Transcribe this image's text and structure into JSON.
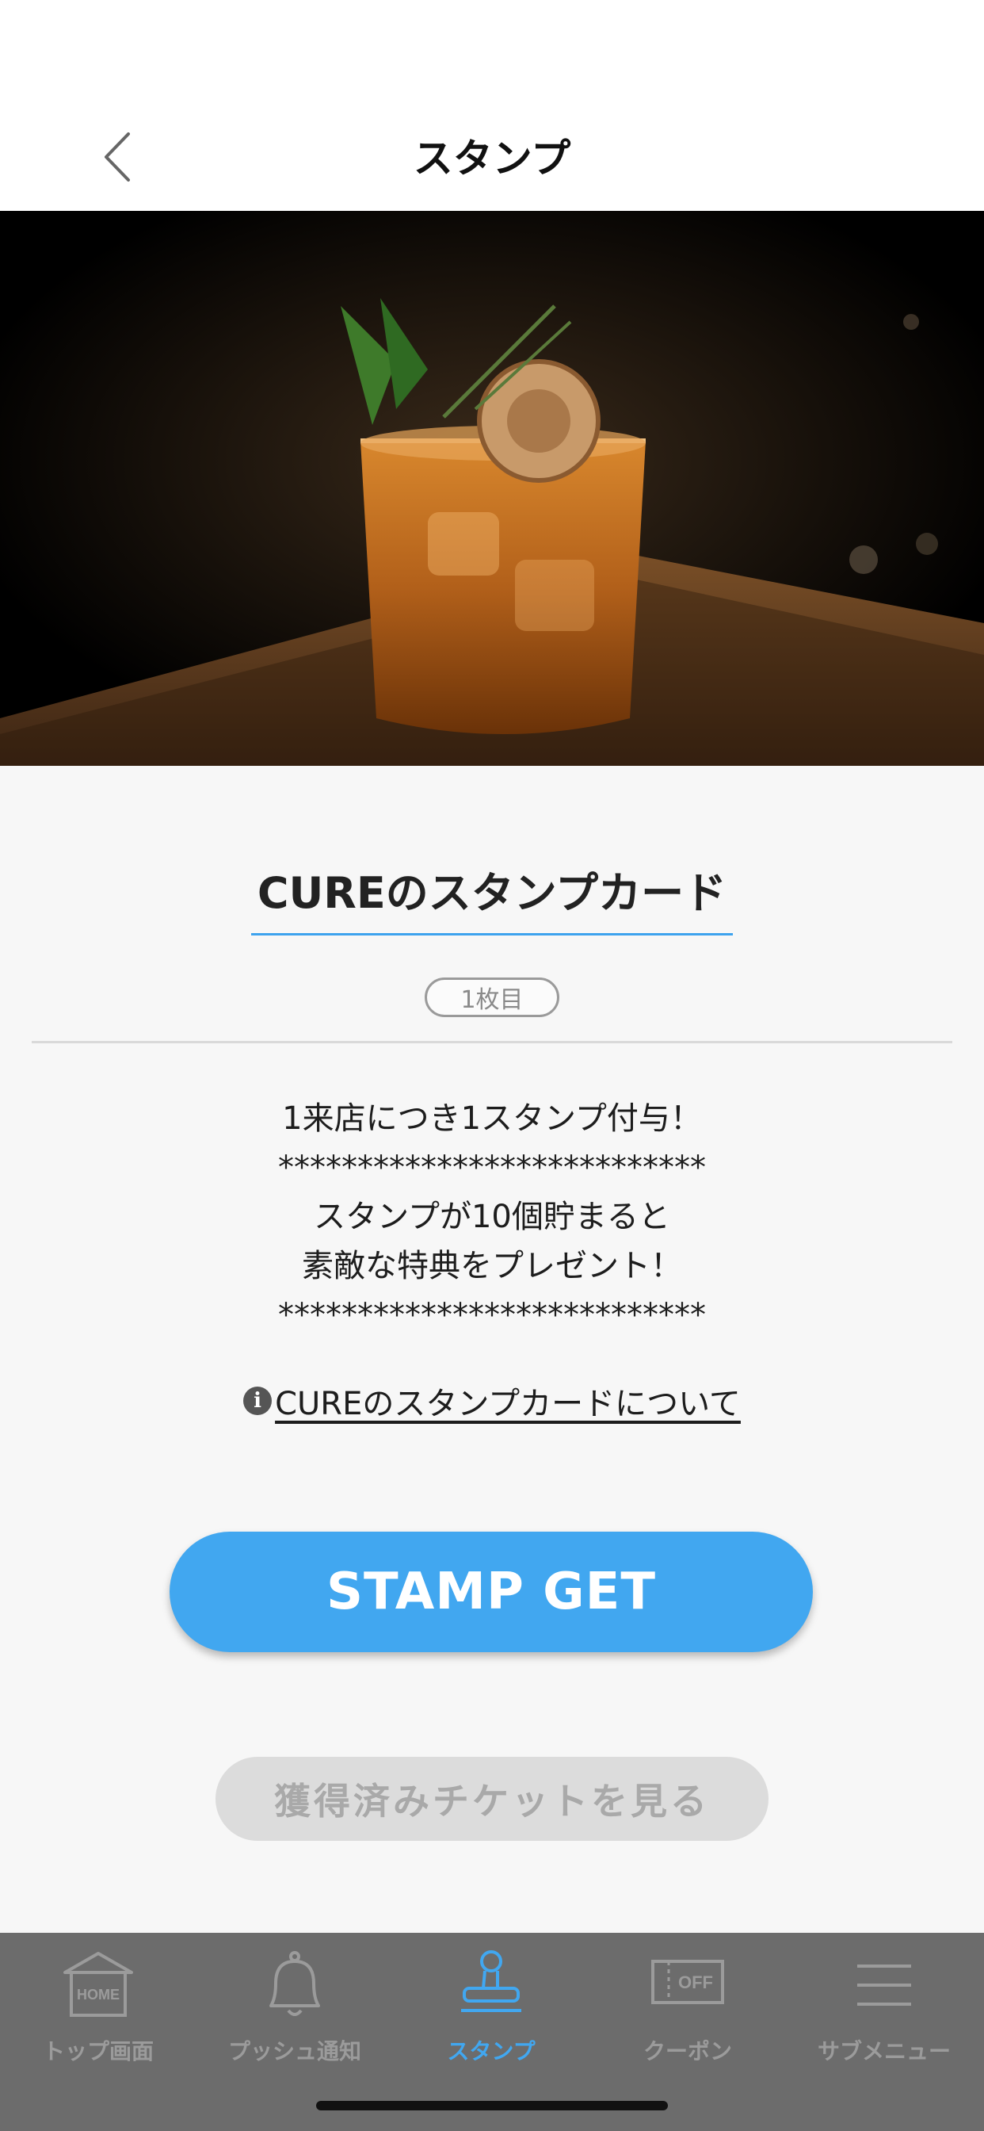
{
  "header": {
    "title": "スタンプ"
  },
  "card": {
    "title": "CUREのスタンプカード",
    "sheet": "1枚目",
    "description": [
      "1来店につき1スタンプ付与！",
      "***************************",
      "スタンプが10個貯まると",
      "素敵な特典をプレゼント！",
      "***************************"
    ],
    "about_link": "CUREのスタンプカードについて"
  },
  "buttons": {
    "stamp_get": "STAMP GET",
    "tickets": "獲得済みチケットを見る"
  },
  "tabbar": {
    "active": "スタンプ",
    "items": [
      {
        "label": "トップ画面",
        "icon": "home-icon",
        "icon_text": "HOME"
      },
      {
        "label": "プッシュ通知",
        "icon": "bell-icon"
      },
      {
        "label": "スタンプ",
        "icon": "stamp-icon"
      },
      {
        "label": "クーポン",
        "icon": "coupon-icon",
        "icon_text": "OFF"
      },
      {
        "label": "サブメニュー",
        "icon": "menu-icon"
      }
    ]
  },
  "colors": {
    "accent": "#41a7f0",
    "tabbar": "#6c6c6c",
    "disabled": "#dcdcdc"
  }
}
